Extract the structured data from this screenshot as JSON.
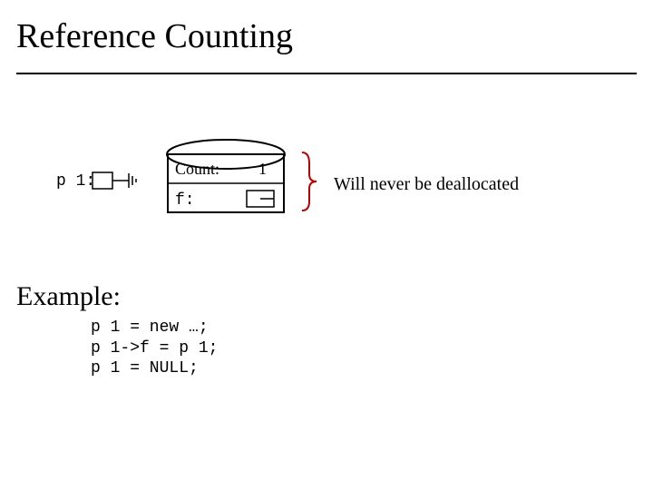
{
  "title": "Reference Counting",
  "diagram": {
    "p1_label": "p 1:",
    "count_label": "Count:",
    "count_value": "1",
    "f_label": "f:"
  },
  "annotation": "Will never be deallocated",
  "example_heading": "Example:",
  "code_lines": "p 1 = new …;\np 1->f = p 1;\np 1 = NULL;"
}
